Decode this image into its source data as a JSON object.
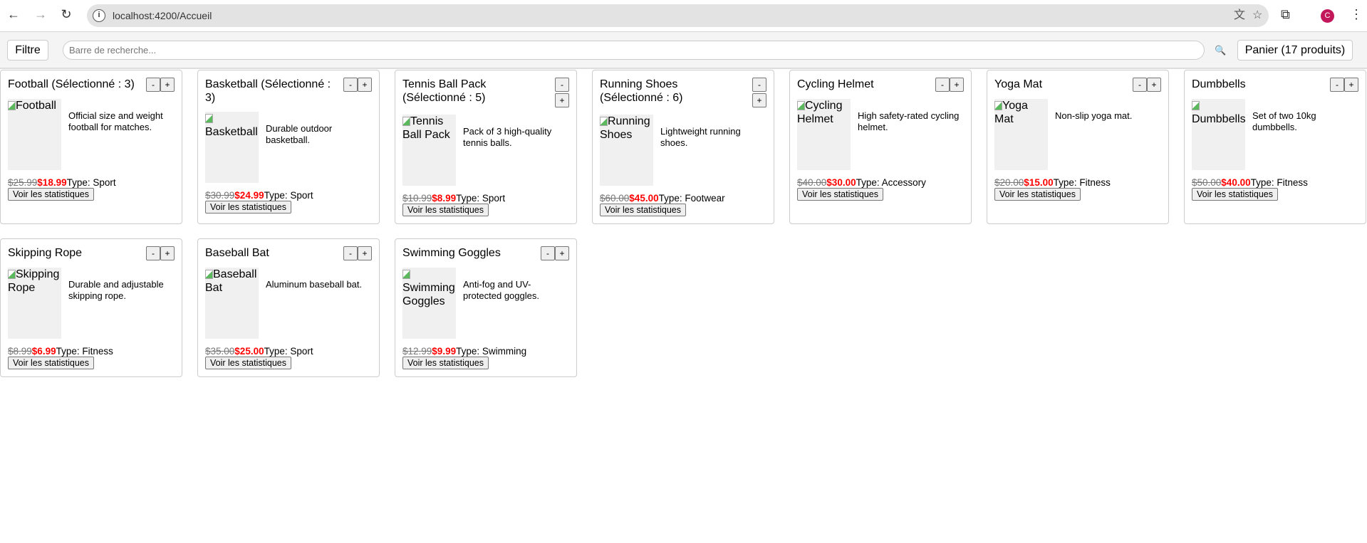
{
  "browser": {
    "url": "localhost:4200/Accueil",
    "avatar_letter": "C"
  },
  "toolbar": {
    "filter_label": "Filtre",
    "search_placeholder": "Barre de recherche...",
    "search_icon": "magnifier-icon",
    "cart_label": "Panier (17 produits)"
  },
  "products": [
    {
      "title": "Football (Sélectionné : 3)",
      "alt": "Football",
      "desc": "Official size and weight football for matches.",
      "old": "$25.99",
      "new": "$18.99",
      "type": "Type: Sport"
    },
    {
      "title": "Basketball (Sélectionné : 3)",
      "alt": "Basketball",
      "desc": "Durable outdoor basketball.",
      "old": "$30.99",
      "new": "$24.99",
      "type": "Type: Sport"
    },
    {
      "title": "Tennis Ball Pack (Sélectionné : 5)",
      "alt": "Tennis Ball Pack",
      "desc": "Pack of 3 high-quality tennis balls.",
      "old": "$10.99",
      "new": "$8.99",
      "type": "Type: Sport"
    },
    {
      "title": "Running Shoes (Sélectionné : 6)",
      "alt": "Running Shoes",
      "desc": "Lightweight running shoes.",
      "old": "$60.00",
      "new": "$45.00",
      "type": "Type: Footwear"
    },
    {
      "title": "Cycling Helmet",
      "alt": "Cycling Helmet",
      "desc": "High safety-rated cycling helmet.",
      "old": "$40.00",
      "new": "$30.00",
      "type": "Type: Accessory"
    },
    {
      "title": "Yoga Mat",
      "alt": "Yoga Mat",
      "desc": "Non-slip yoga mat.",
      "old": "$20.00",
      "new": "$15.00",
      "type": "Type: Fitness"
    },
    {
      "title": "Dumbbells",
      "alt": "Dumbbells",
      "desc": "Set of two 10kg dumbbells.",
      "old": "$50.00",
      "new": "$40.00",
      "type": "Type: Fitness"
    },
    {
      "title": "Skipping Rope",
      "alt": "Skipping Rope",
      "desc": "Durable and adjustable skipping rope.",
      "old": "$8.99",
      "new": "$6.99",
      "type": "Type: Fitness"
    },
    {
      "title": "Baseball Bat",
      "alt": "Baseball Bat",
      "desc": "Aluminum baseball bat.",
      "old": "$35.00",
      "new": "$25.00",
      "type": "Type: Sport"
    },
    {
      "title": "Swimming Goggles",
      "alt": "Swimming Goggles",
      "desc": "Anti-fog and UV-protected goggles.",
      "old": "$12.99",
      "new": "$9.99",
      "type": "Type: Swimming"
    }
  ],
  "labels": {
    "minus": "-",
    "plus": "+",
    "stats": "Voir les statistiques"
  }
}
